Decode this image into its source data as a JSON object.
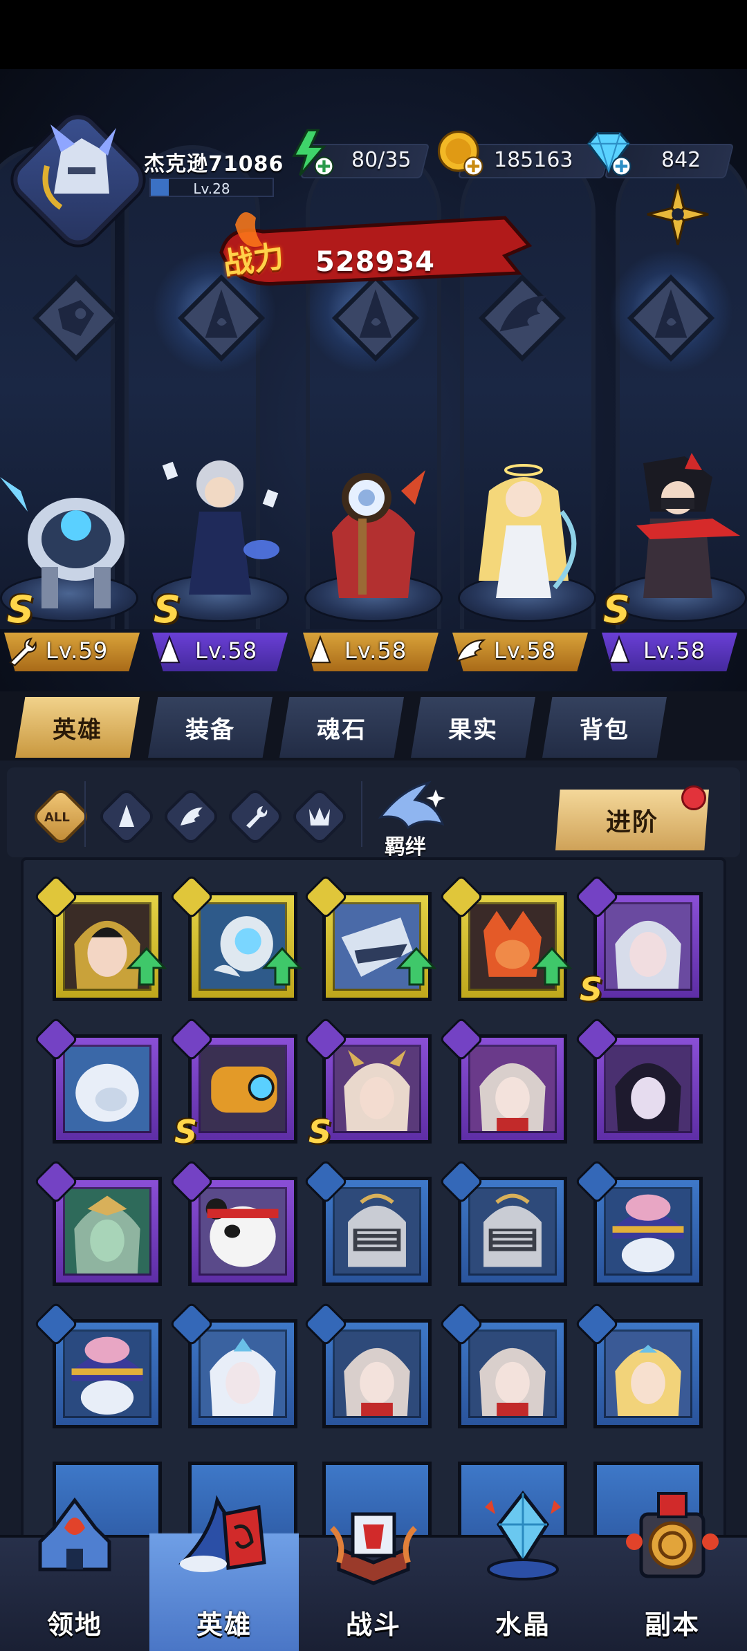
{
  "player": {
    "name": "杰克逊71086",
    "level": "Lv.28",
    "level_progress": 0.15
  },
  "resources": {
    "energy": "80/35",
    "gold": "185163",
    "gems": "842"
  },
  "power": {
    "label": "战力",
    "value": "528934"
  },
  "team": [
    {
      "level": "Lv.59",
      "plate": "gold",
      "class_icon": "wrench-icon",
      "s_rank": true
    },
    {
      "level": "Lv.58",
      "plate": "purple",
      "class_icon": "wizard-hat-icon",
      "s_rank": true
    },
    {
      "level": "Lv.58",
      "plate": "gold",
      "class_icon": "wizard-hat-icon",
      "s_rank": false
    },
    {
      "level": "Lv.58",
      "plate": "gold",
      "class_icon": "wing-icon",
      "s_rank": false
    },
    {
      "level": "Lv.58",
      "plate": "purple",
      "class_icon": "wizard-hat-icon",
      "s_rank": true
    }
  ],
  "tabs": [
    "英雄",
    "装备",
    "魂石",
    "果实",
    "背包"
  ],
  "active_tab": 0,
  "filters": {
    "all_label": "ALL",
    "bond_label": "羁绊",
    "advance_label": "进阶"
  },
  "bottom_nav": [
    "领地",
    "英雄",
    "战斗",
    "水晶",
    "副本"
  ],
  "active_nav": 1,
  "colors": {
    "gold_tab": "#c9983f",
    "yellow_card": "#e4d246",
    "purple_card": "#8a4fd6",
    "blue_card": "#3e78c8",
    "active_nav": "#6f9fe6"
  }
}
